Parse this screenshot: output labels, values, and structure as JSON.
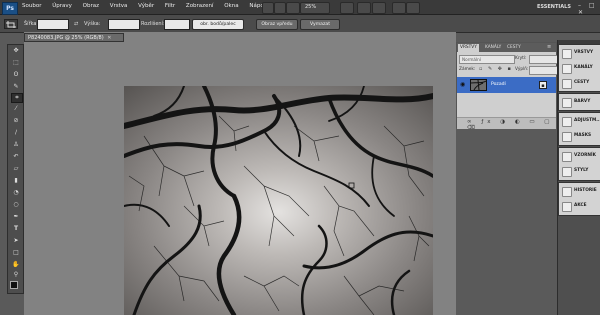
{
  "menubar": {
    "app_logo": "Ps",
    "items": [
      "Soubor",
      "Úpravy",
      "Obraz",
      "Vrstva",
      "Výběr",
      "Filtr",
      "Zobrazení",
      "Okna",
      "Nápověda"
    ],
    "zoom": "25%",
    "workspace": "ESSENTIALS",
    "window_controls": "– □ ✕"
  },
  "options_bar": {
    "width_label": "Šířka:",
    "height_label": "Výška:",
    "resolution_label": "Rozlišení:",
    "resolution_unit": "obr. bodů/palec",
    "front_image_button": "Obraz vpředu",
    "clear_button": "Vymazat"
  },
  "document": {
    "tab_title": "P8240083.JPG @ 25% (RGB/8)"
  },
  "layers_panel": {
    "tabs": [
      "VRSTVY",
      "KANÁLY",
      "CESTY"
    ],
    "blend_mode": "Normální",
    "opacity_label": "Krytí:",
    "lock_label": "Zámek:",
    "fill_label": "Výplň:",
    "layer_name": "Pozadí"
  },
  "dock": {
    "items": [
      "VRSTVY",
      "KANÁLY",
      "CESTY",
      "BARVY",
      "ADJUSTM...",
      "MASKS",
      "VZORNÍK",
      "STYLY",
      "HISTORIE",
      "AKCE"
    ]
  },
  "colors": {
    "ui_dark": "#3a3a3a",
    "ui_mid": "#4b4b4b",
    "panel_light": "#cfcfcf",
    "layer_selected": "#3b6cc5",
    "logo_blue": "#1a4f86"
  }
}
